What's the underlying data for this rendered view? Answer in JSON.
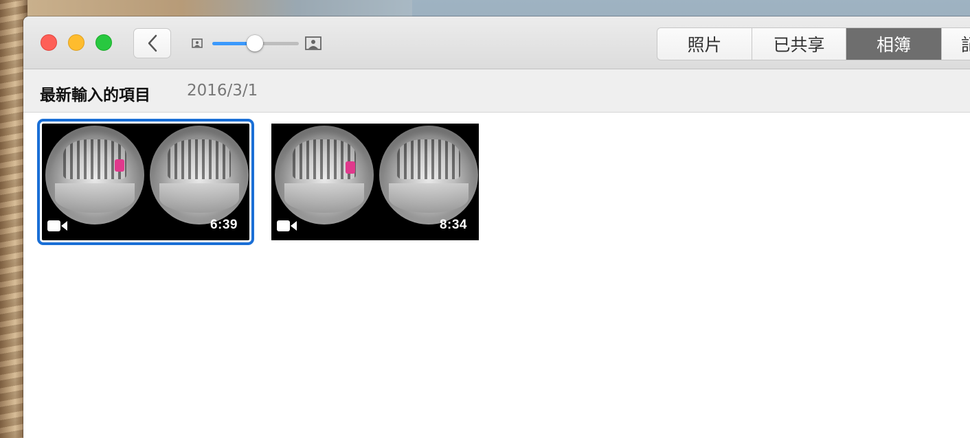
{
  "window": {
    "tabs": [
      {
        "label": "照片"
      },
      {
        "label": "已共享"
      },
      {
        "label": "相簿"
      },
      {
        "label": "記"
      }
    ],
    "active_tab": "相簿",
    "zoom_slider": {
      "value_fraction": 0.5
    }
  },
  "section": {
    "title": "最新輸入的項目",
    "date": "2016/3/1"
  },
  "items": [
    {
      "type": "video",
      "duration": "6:39",
      "selected": true
    },
    {
      "type": "video",
      "duration": "8:34",
      "selected": false
    }
  ],
  "colors": {
    "accent": "#3b99fc",
    "selection": "#1a6fd6",
    "close": "#fe5f57",
    "minimize": "#febc2e",
    "maximize": "#28c840"
  },
  "icons": [
    "chevron-left-icon",
    "small-photo-icon",
    "large-photo-icon",
    "video-camera-icon"
  ]
}
